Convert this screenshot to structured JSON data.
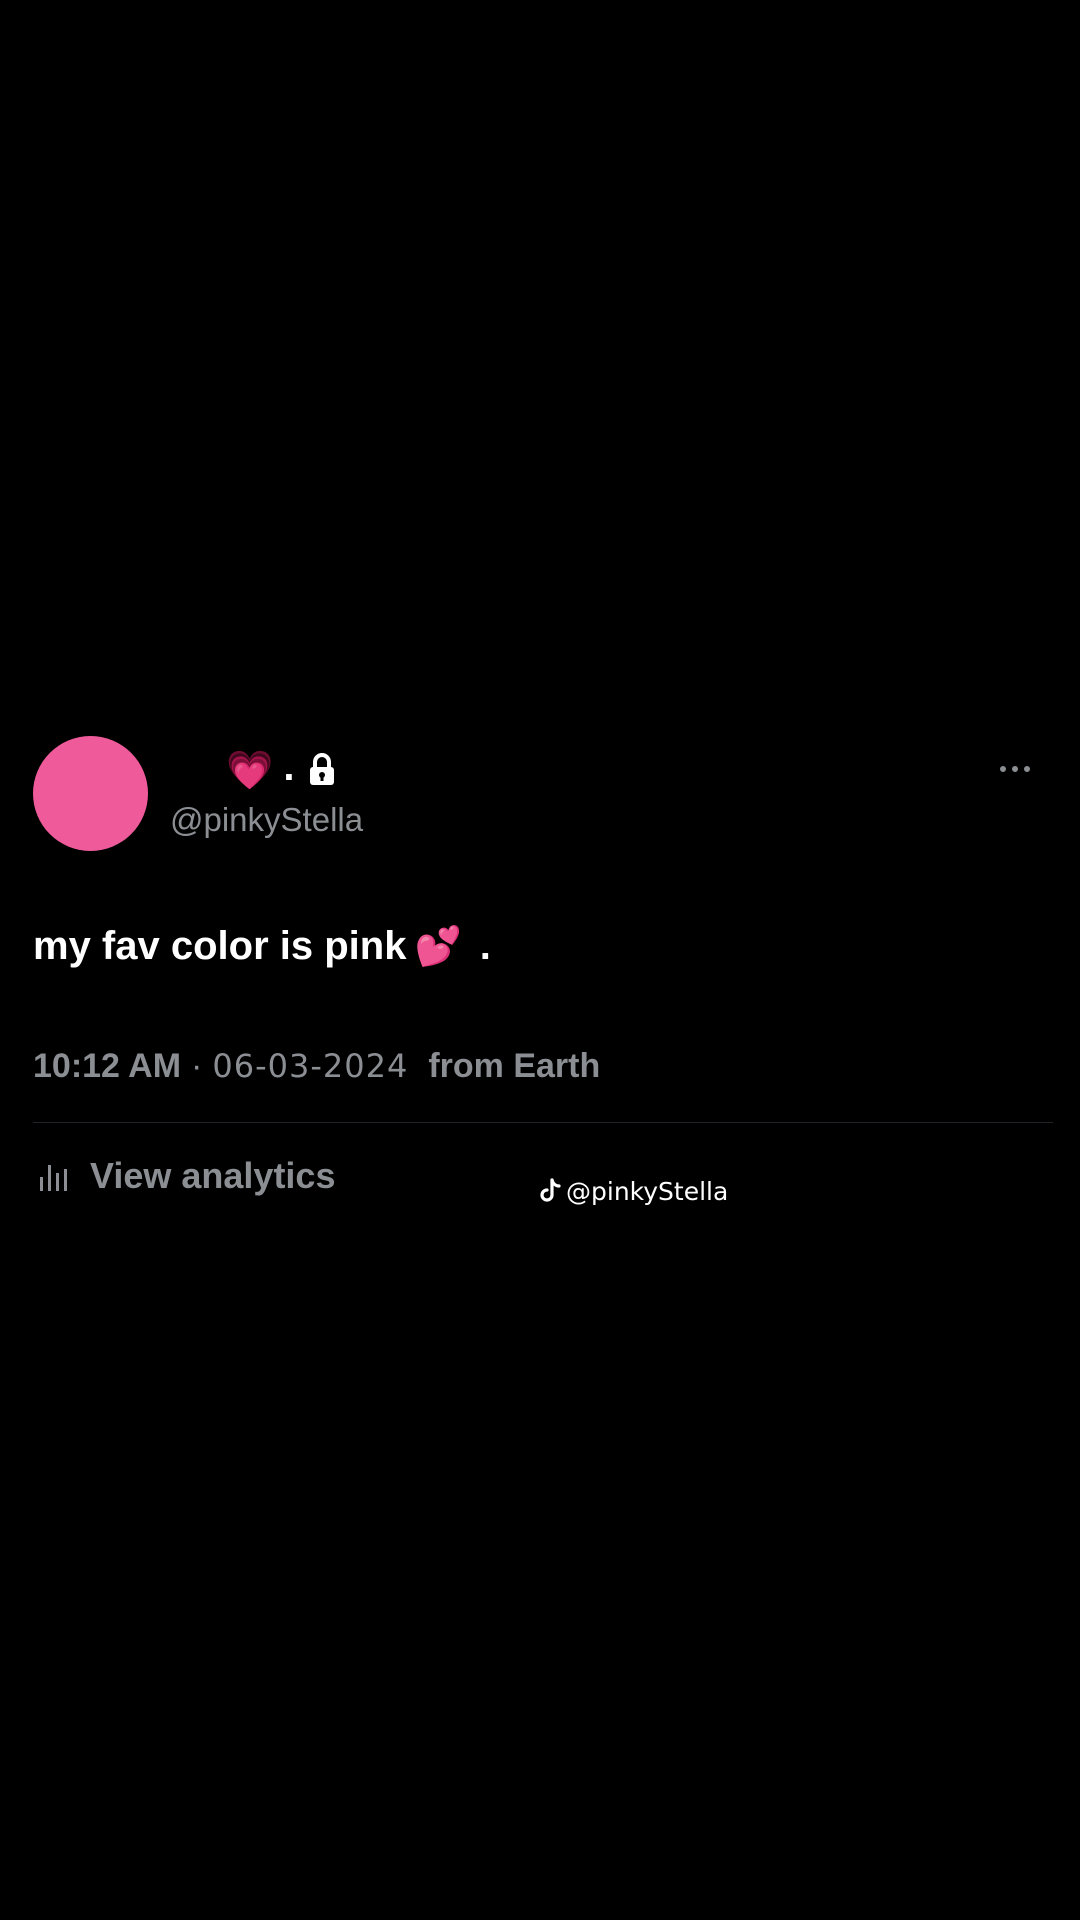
{
  "profile": {
    "display_name_emoji": "💗",
    "display_name_separator": ".",
    "handle": "@pinkyStella",
    "avatar_color": "#ef5a9b",
    "lock_icon": "lock-icon",
    "more_icon": "more-horizontal-icon"
  },
  "tweet": {
    "text": "my fav color is pink",
    "emoji": "💕",
    "trailing": "."
  },
  "meta": {
    "time": "10:12 AM",
    "separator": "·",
    "date": "06-03-2024",
    "source": "from Earth"
  },
  "analytics": {
    "icon": "bar-chart-icon",
    "label": "View analytics"
  },
  "watermark": {
    "icon": "tiktok-icon",
    "handle": "@pinkyStella"
  },
  "colors": {
    "background": "#000000",
    "primary_text": "#ffffff",
    "secondary_text": "#8b8f93",
    "accent_pink": "#ef5a9b"
  }
}
